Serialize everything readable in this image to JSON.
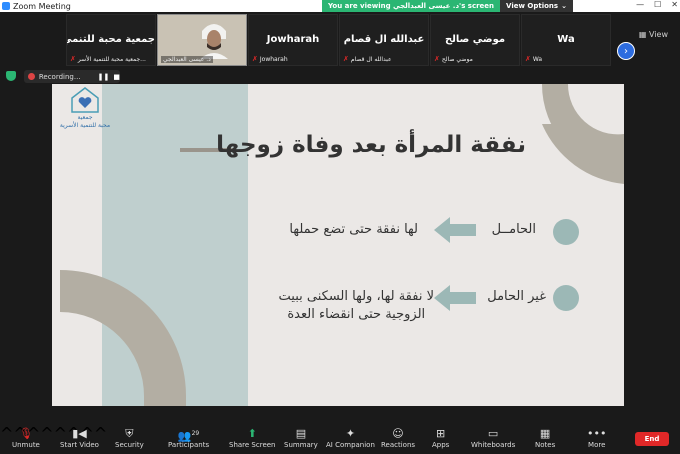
{
  "window": {
    "title": "Zoom Meeting"
  },
  "banner": {
    "viewing_text": "You are viewing د. عيسى العبدالجي's screen",
    "view_options_label": "View Options"
  },
  "participants": [
    {
      "name": "جمعية محبة للتنمي...",
      "sub": "جمعية محبة للتنمية الأسر..."
    },
    {
      "name": "",
      "sub": "د. عيسى العبدالجي"
    },
    {
      "name": "Jowharah",
      "sub": "Jowharah"
    },
    {
      "name": "عبدالله ال قصام",
      "sub": "عبدالله ال قصام"
    },
    {
      "name": "موضي صالح",
      "sub": "موضي صالح"
    },
    {
      "name": "Wa",
      "sub": "Wa"
    }
  ],
  "strip": {
    "view_label": "View"
  },
  "recording": {
    "label": "Recording..."
  },
  "slide": {
    "logo_line1": "جمعية",
    "logo_line2": "محبة للتنمية الأسرية",
    "title": "نفقة المرأة بعد وفاة زوجها",
    "item1_label": "الحامــل",
    "item1_text": "لها نفقة حتى تضع حملها",
    "item2_label": "غير الحامل",
    "item2_text_line1": "لا نفقة لها، ولها السكنى ببيت",
    "item2_text_line2": "الزوجية حتى انقضاء العدة"
  },
  "toolbar": {
    "unmute": "Unmute",
    "start_video": "Start Video",
    "security": "Security",
    "participants": "Participants",
    "participants_count": "29",
    "share_screen": "Share Screen",
    "summary": "Summary",
    "ai_companion": "AI Companion",
    "reactions": "Reactions",
    "apps": "Apps",
    "whiteboards": "Whiteboards",
    "notes": "Notes",
    "more": "More",
    "end": "End"
  },
  "colors": {
    "accent_green": "#2bb673",
    "end_red": "#e02828",
    "slide_teal": "#9cb8b6",
    "slide_taupe": "#b3aea3"
  }
}
